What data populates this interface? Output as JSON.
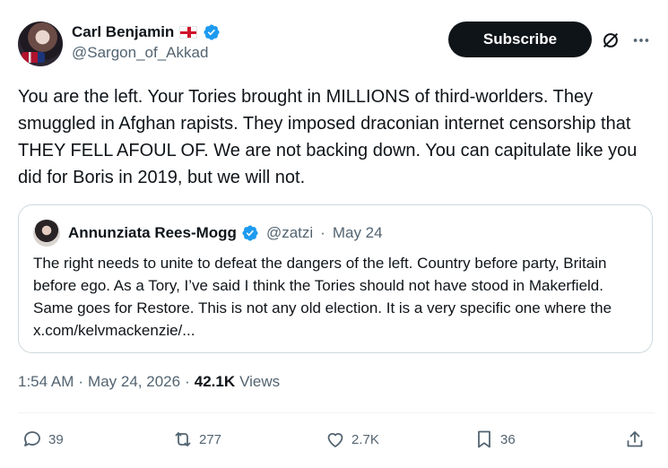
{
  "author": {
    "display_name": "Carl Benjamin",
    "handle": "@Sargon_of_Akkad",
    "flag": "england-flag"
  },
  "buttons": {
    "subscribe": "Subscribe"
  },
  "tweet": {
    "text": "You are the left. Your Tories brought in MILLIONS of third-worlders. They smuggled in Afghan rapists. They imposed draconian internet censorship that THEY FELL AFOUL OF.  We are not backing down. You can capitulate like you did for Boris in 2019, but we will not."
  },
  "quoted": {
    "name": "Annunziata Rees-Mogg",
    "handle": "@zatzi",
    "separator": "·",
    "date": "May 24",
    "text": "The right needs to unite to defeat the dangers of the left.  Country before party, Britain before ego.  As a Tory, I’ve said I think the Tories should not have stood in Makerfield.  Same goes for Restore.  This is not any old election. It is a very specific one where the x.com/kelvmackenzie/..."
  },
  "meta": {
    "time": "1:54 AM",
    "sep1": "·",
    "date": "May 24, 2026",
    "sep2": "·",
    "views_count": "42.1K",
    "views_label": "Views"
  },
  "actions": {
    "replies": "39",
    "reposts": "277",
    "likes": "2.7K",
    "bookmarks": "36"
  },
  "colors": {
    "verified": "#1d9bf0",
    "text": "#0f1419",
    "muted": "#536471",
    "border": "#cfd9de"
  }
}
